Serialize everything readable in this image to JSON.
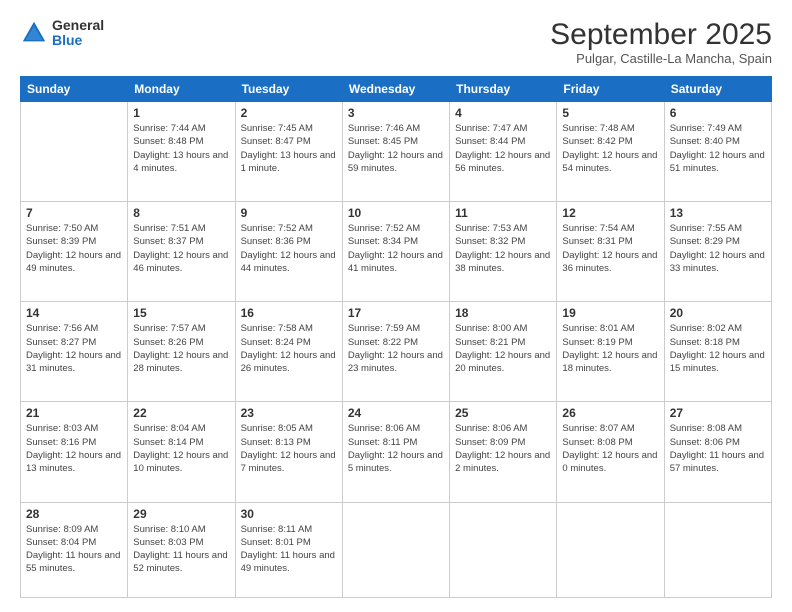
{
  "logo": {
    "general": "General",
    "blue": "Blue"
  },
  "header": {
    "month": "September 2025",
    "location": "Pulgar, Castille-La Mancha, Spain"
  },
  "weekdays": [
    "Sunday",
    "Monday",
    "Tuesday",
    "Wednesday",
    "Thursday",
    "Friday",
    "Saturday"
  ],
  "weeks": [
    [
      {
        "day": "",
        "info": ""
      },
      {
        "day": "1",
        "info": "Sunrise: 7:44 AM\nSunset: 8:48 PM\nDaylight: 13 hours\nand 4 minutes."
      },
      {
        "day": "2",
        "info": "Sunrise: 7:45 AM\nSunset: 8:47 PM\nDaylight: 13 hours\nand 1 minute."
      },
      {
        "day": "3",
        "info": "Sunrise: 7:46 AM\nSunset: 8:45 PM\nDaylight: 12 hours\nand 59 minutes."
      },
      {
        "day": "4",
        "info": "Sunrise: 7:47 AM\nSunset: 8:44 PM\nDaylight: 12 hours\nand 56 minutes."
      },
      {
        "day": "5",
        "info": "Sunrise: 7:48 AM\nSunset: 8:42 PM\nDaylight: 12 hours\nand 54 minutes."
      },
      {
        "day": "6",
        "info": "Sunrise: 7:49 AM\nSunset: 8:40 PM\nDaylight: 12 hours\nand 51 minutes."
      }
    ],
    [
      {
        "day": "7",
        "info": "Sunrise: 7:50 AM\nSunset: 8:39 PM\nDaylight: 12 hours\nand 49 minutes."
      },
      {
        "day": "8",
        "info": "Sunrise: 7:51 AM\nSunset: 8:37 PM\nDaylight: 12 hours\nand 46 minutes."
      },
      {
        "day": "9",
        "info": "Sunrise: 7:52 AM\nSunset: 8:36 PM\nDaylight: 12 hours\nand 44 minutes."
      },
      {
        "day": "10",
        "info": "Sunrise: 7:52 AM\nSunset: 8:34 PM\nDaylight: 12 hours\nand 41 minutes."
      },
      {
        "day": "11",
        "info": "Sunrise: 7:53 AM\nSunset: 8:32 PM\nDaylight: 12 hours\nand 38 minutes."
      },
      {
        "day": "12",
        "info": "Sunrise: 7:54 AM\nSunset: 8:31 PM\nDaylight: 12 hours\nand 36 minutes."
      },
      {
        "day": "13",
        "info": "Sunrise: 7:55 AM\nSunset: 8:29 PM\nDaylight: 12 hours\nand 33 minutes."
      }
    ],
    [
      {
        "day": "14",
        "info": "Sunrise: 7:56 AM\nSunset: 8:27 PM\nDaylight: 12 hours\nand 31 minutes."
      },
      {
        "day": "15",
        "info": "Sunrise: 7:57 AM\nSunset: 8:26 PM\nDaylight: 12 hours\nand 28 minutes."
      },
      {
        "day": "16",
        "info": "Sunrise: 7:58 AM\nSunset: 8:24 PM\nDaylight: 12 hours\nand 26 minutes."
      },
      {
        "day": "17",
        "info": "Sunrise: 7:59 AM\nSunset: 8:22 PM\nDaylight: 12 hours\nand 23 minutes."
      },
      {
        "day": "18",
        "info": "Sunrise: 8:00 AM\nSunset: 8:21 PM\nDaylight: 12 hours\nand 20 minutes."
      },
      {
        "day": "19",
        "info": "Sunrise: 8:01 AM\nSunset: 8:19 PM\nDaylight: 12 hours\nand 18 minutes."
      },
      {
        "day": "20",
        "info": "Sunrise: 8:02 AM\nSunset: 8:18 PM\nDaylight: 12 hours\nand 15 minutes."
      }
    ],
    [
      {
        "day": "21",
        "info": "Sunrise: 8:03 AM\nSunset: 8:16 PM\nDaylight: 12 hours\nand 13 minutes."
      },
      {
        "day": "22",
        "info": "Sunrise: 8:04 AM\nSunset: 8:14 PM\nDaylight: 12 hours\nand 10 minutes."
      },
      {
        "day": "23",
        "info": "Sunrise: 8:05 AM\nSunset: 8:13 PM\nDaylight: 12 hours\nand 7 minutes."
      },
      {
        "day": "24",
        "info": "Sunrise: 8:06 AM\nSunset: 8:11 PM\nDaylight: 12 hours\nand 5 minutes."
      },
      {
        "day": "25",
        "info": "Sunrise: 8:06 AM\nSunset: 8:09 PM\nDaylight: 12 hours\nand 2 minutes."
      },
      {
        "day": "26",
        "info": "Sunrise: 8:07 AM\nSunset: 8:08 PM\nDaylight: 12 hours\nand 0 minutes."
      },
      {
        "day": "27",
        "info": "Sunrise: 8:08 AM\nSunset: 8:06 PM\nDaylight: 11 hours\nand 57 minutes."
      }
    ],
    [
      {
        "day": "28",
        "info": "Sunrise: 8:09 AM\nSunset: 8:04 PM\nDaylight: 11 hours\nand 55 minutes."
      },
      {
        "day": "29",
        "info": "Sunrise: 8:10 AM\nSunset: 8:03 PM\nDaylight: 11 hours\nand 52 minutes."
      },
      {
        "day": "30",
        "info": "Sunrise: 8:11 AM\nSunset: 8:01 PM\nDaylight: 11 hours\nand 49 minutes."
      },
      {
        "day": "",
        "info": ""
      },
      {
        "day": "",
        "info": ""
      },
      {
        "day": "",
        "info": ""
      },
      {
        "day": "",
        "info": ""
      }
    ]
  ]
}
